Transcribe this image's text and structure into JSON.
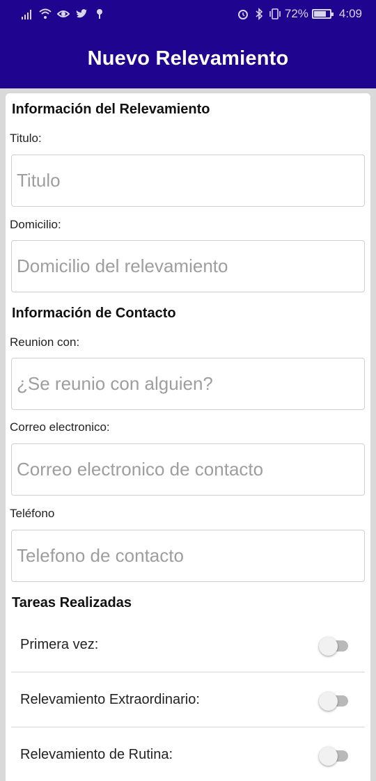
{
  "status_bar": {
    "battery_percent": "72%",
    "time": "4:09",
    "left_icons": [
      "signal-icon",
      "wifi-icon",
      "eye-icon",
      "twitter-icon",
      "location-icon"
    ],
    "right_icons": [
      "alarm-icon",
      "bluetooth-icon",
      "vibrate-icon",
      "battery-icon"
    ]
  },
  "app_bar": {
    "title": "Nuevo Relevamiento",
    "color": "#1f0490"
  },
  "sections": {
    "survey_info": {
      "title": "Información del Relevamiento"
    },
    "contact_info": {
      "title": "Información de Contacto"
    },
    "tasks": {
      "title": "Tareas Realizadas"
    }
  },
  "fields": {
    "titulo": {
      "label": "Titulo:",
      "placeholder": "Titulo",
      "value": ""
    },
    "domicilio": {
      "label": "Domicilio:",
      "placeholder": "Domicilio del relevamiento",
      "value": ""
    },
    "reunion": {
      "label": "Reunion con:",
      "placeholder": "¿Se reunio con alguien?",
      "value": ""
    },
    "correo": {
      "label": "Correo electronico:",
      "placeholder": "Correo electronico de contacto",
      "value": ""
    },
    "telefono": {
      "label": "Teléfono",
      "placeholder": "Telefono de contacto",
      "value": ""
    }
  },
  "tasks": [
    {
      "label": "Primera vez:",
      "checked": false
    },
    {
      "label": "Relevamiento Extraordinario:",
      "checked": false
    },
    {
      "label": "Relevamiento de Rutina:",
      "checked": false
    }
  ]
}
